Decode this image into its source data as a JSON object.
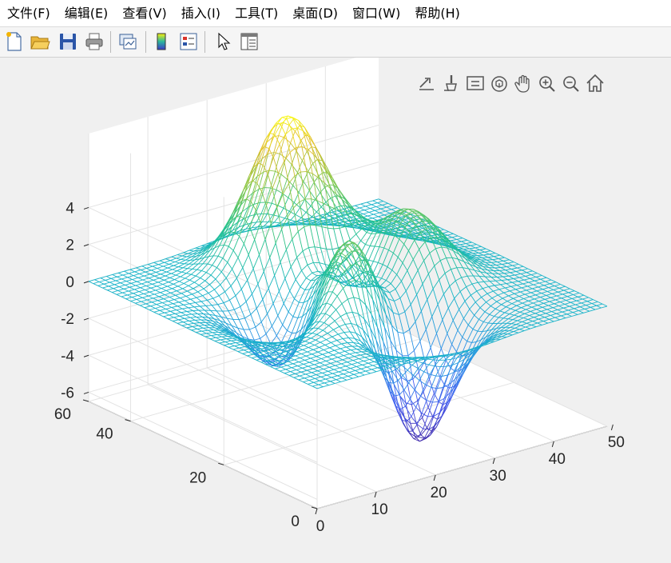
{
  "menu": {
    "file": "文件(F)",
    "edit": "编辑(E)",
    "view": "查看(V)",
    "insert": "插入(I)",
    "tools": "工具(T)",
    "desktop": "桌面(D)",
    "window": "窗口(W)",
    "help": "帮助(H)"
  },
  "toolbar_icons": [
    "new-figure-icon",
    "open-folder-icon",
    "save-icon",
    "print-icon",
    "link-plot-icon",
    "colorbar-icon",
    "legend-icon",
    "edit-plot-arrow-icon",
    "property-inspector-icon"
  ],
  "axes_toolbar_icons": [
    "export-icon",
    "brush-icon",
    "data-tips-icon",
    "rotate-3d-icon",
    "pan-hand-icon",
    "zoom-in-icon",
    "zoom-out-icon",
    "restore-view-home-icon"
  ],
  "chart_data": {
    "type": "surface-mesh",
    "function": "peaks",
    "x": {
      "ticks": [
        "0",
        "10",
        "20",
        "30",
        "40",
        "50"
      ],
      "range": [
        0,
        49
      ]
    },
    "y": {
      "ticks": [
        "0",
        "20",
        "40",
        "60"
      ],
      "range": [
        0,
        49
      ]
    },
    "z": {
      "ticks": [
        "-6",
        "-4",
        "-2",
        "0",
        "2",
        "4"
      ],
      "range": [
        -6.5,
        8
      ]
    },
    "grid": true,
    "colormap": "parula"
  }
}
